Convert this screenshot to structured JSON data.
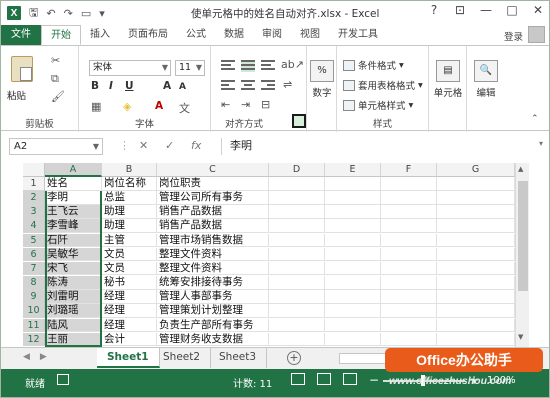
{
  "window": {
    "title": "使单元格中的姓名自动对齐.xlsx - Excel",
    "app_icon": "X",
    "controls": [
      "?",
      "⊡",
      "—",
      "□",
      "✕"
    ]
  },
  "tabs": [
    "文件",
    "开始",
    "插入",
    "页面布局",
    "公式",
    "数据",
    "审阅",
    "视图",
    "开发工具"
  ],
  "active_tab": "开始",
  "account": "登录",
  "ribbon": {
    "clipboard": {
      "paste": "粘贴",
      "label": "剪贴板"
    },
    "font": {
      "name": "宋体",
      "size": "11",
      "bold": "B",
      "italic": "I",
      "underline": "U",
      "grow": "A",
      "shrink": "A",
      "color_a": "A",
      "label": "字体"
    },
    "alignment": {
      "label": "对齐方式"
    },
    "number": {
      "btn": "数字",
      "percent": "%"
    },
    "styles": {
      "conditional": "条件格式",
      "table": "套用表格格式",
      "cell": "单元格样式",
      "label": "样式"
    },
    "cells": {
      "btn": "单元格"
    },
    "editing": {
      "btn": "编辑"
    }
  },
  "formula_bar": {
    "name_box": "A2",
    "cancel": "✕",
    "enter": "✓",
    "fx": "fx",
    "value": "李明"
  },
  "grid": {
    "columns": [
      "A",
      "B",
      "C",
      "D",
      "E",
      "F",
      "G"
    ],
    "rows": [
      [
        "1",
        "姓名",
        "岗位名称",
        "岗位职责"
      ],
      [
        "2",
        "李明",
        "总监",
        "管理公司所有事务"
      ],
      [
        "3",
        "王飞云",
        "助理",
        "销售产品数据"
      ],
      [
        "4",
        "李雪峰",
        "助理",
        "销售产品数据"
      ],
      [
        "5",
        "石阡",
        "主管",
        "管理市场销售数据"
      ],
      [
        "6",
        "吴敏华",
        "文员",
        "整理文件资料"
      ],
      [
        "7",
        "宋飞",
        "文员",
        "整理文件资料"
      ],
      [
        "8",
        "陈涛",
        "秘书",
        "统筹安排接待事务"
      ],
      [
        "9",
        "刘雷明",
        "经理",
        "管理人事部事务"
      ],
      [
        "10",
        "刘璐瑶",
        "经理",
        "管理策划计划整理"
      ],
      [
        "11",
        "陆风",
        "经理",
        "负责生产部所有事务"
      ],
      [
        "12",
        "王丽",
        "会计",
        "管理财务收支数据"
      ]
    ]
  },
  "sheets": [
    "Sheet1",
    "Sheet2",
    "Sheet3"
  ],
  "active_sheet": "Sheet1",
  "status": {
    "ready": "就绪",
    "count": "计数: 11",
    "zoom": "100%"
  },
  "watermark": {
    "badge": "Office办公助手",
    "site": "www.officezhushou.com"
  },
  "colors": {
    "excel_green": "#217346",
    "badge_orange": "#e95b1b"
  }
}
